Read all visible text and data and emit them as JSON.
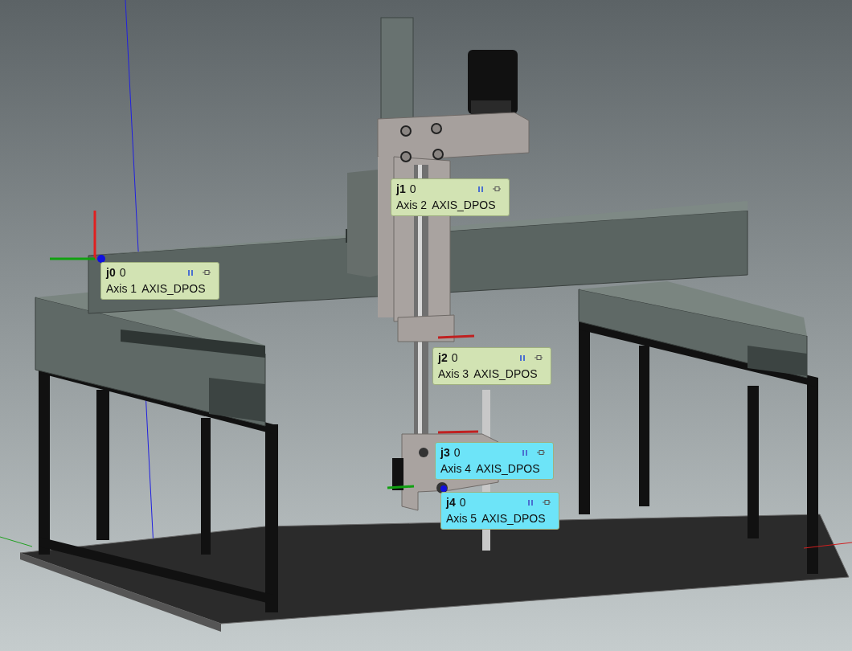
{
  "joints": [
    {
      "name": "j0",
      "value": "0",
      "axis": "Axis 1",
      "source": "AXIS_DPOS",
      "color": "#d2e3b3"
    },
    {
      "name": "j1",
      "value": "0",
      "axis": "Axis 2",
      "source": "AXIS_DPOS",
      "color": "#d2e3b3"
    },
    {
      "name": "j2",
      "value": "0",
      "axis": "Axis 3",
      "source": "AXIS_DPOS",
      "color": "#d2e3b3"
    },
    {
      "name": "j3",
      "value": "0",
      "axis": "Axis 4",
      "source": "AXIS_DPOS",
      "color": "#6de4f8"
    },
    {
      "name": "j4",
      "value": "0",
      "axis": "Axis 5",
      "source": "AXIS_DPOS",
      "color": "#6de4f8"
    }
  ]
}
